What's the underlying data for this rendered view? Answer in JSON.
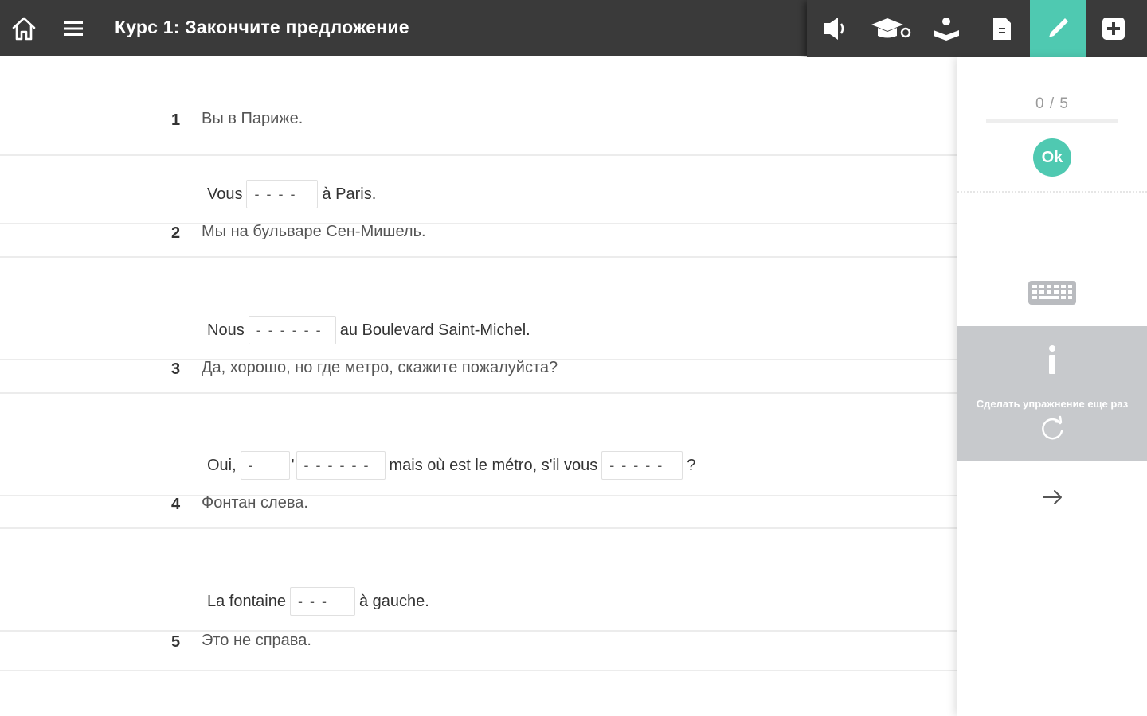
{
  "header": {
    "title": "Курс 1: Закончите предложение",
    "tools": [
      {
        "icon": "speaker-icon",
        "active": false
      },
      {
        "icon": "graduation-cap-icon",
        "active": false
      },
      {
        "icon": "open-book-icon",
        "active": false
      },
      {
        "icon": "document-icon",
        "active": false
      },
      {
        "icon": "pencil-icon",
        "active": true
      },
      {
        "icon": "plus-box-icon",
        "active": false
      }
    ],
    "accent_color": "#4fc9b1",
    "bar_color": "#3a3a3a"
  },
  "exercise": {
    "questions": [
      {
        "num": "1",
        "prompt": "Вы в Париже.",
        "parts": [
          {
            "t": "Vous"
          },
          {
            "blank": "- - - -"
          },
          {
            "t": "à Paris."
          }
        ]
      },
      {
        "num": "2",
        "prompt": "Мы на бульваре Сен-Мишель.",
        "parts": [
          {
            "t": "Nous"
          },
          {
            "blank": "- - - - - -"
          },
          {
            "t": "au Boulevard Saint-Michel."
          }
        ]
      },
      {
        "num": "3",
        "prompt": "Да, хорошо, но где метро, скажите пожалуйста?",
        "parts": [
          {
            "t": "Oui,"
          },
          {
            "blank": "-"
          },
          {
            "t": "'"
          },
          {
            "blank": "- - - - - -"
          },
          {
            "t": "mais où est le métro, s'il vous"
          },
          {
            "blank": "- - - - -"
          },
          {
            "t": "?"
          }
        ]
      },
      {
        "num": "4",
        "prompt": "Фонтан слева.",
        "parts": [
          {
            "t": "La fontaine"
          },
          {
            "blank": "- - -"
          },
          {
            "t": "à gauche."
          }
        ]
      },
      {
        "num": "5",
        "prompt": "Это не справа.",
        "parts": []
      }
    ]
  },
  "side": {
    "score": "0 / 5",
    "ok_label": "Ok",
    "redo_label": "Сделать упражнение еще раз"
  }
}
